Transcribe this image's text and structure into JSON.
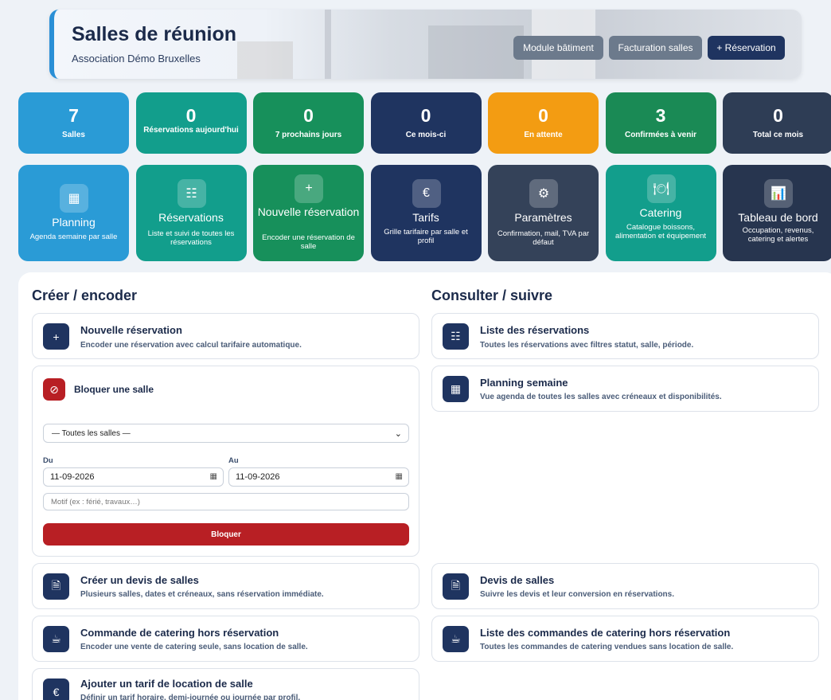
{
  "header": {
    "title": "Salles de réunion",
    "subtitle": "Association Démo Bruxelles",
    "buttons": [
      "Module bâtiment",
      "Facturation salles",
      "+ Réservation"
    ]
  },
  "stats": [
    {
      "value": "7",
      "label": "Salles",
      "color": "#2a9bd6"
    },
    {
      "value": "0",
      "label": "Réservations aujourd'hui",
      "color": "#129e8c"
    },
    {
      "value": "0",
      "label": "7 prochains jours",
      "color": "#17905b"
    },
    {
      "value": "0",
      "label": "Ce mois-ci",
      "color": "#1f3460"
    },
    {
      "value": "0",
      "label": "En attente",
      "color": "#f39c12"
    },
    {
      "value": "3",
      "label": "Confirmées à venir",
      "color": "#1a8a55"
    },
    {
      "value": "0",
      "label": "Total ce mois",
      "color": "#2e3d55"
    }
  ],
  "modules": [
    {
      "icon": "calendar-icon",
      "glyph": "▦",
      "title": "Planning",
      "desc": "Agenda semaine par salle",
      "color": "#2a9bd6"
    },
    {
      "icon": "list-icon",
      "glyph": "☷",
      "title": "Réservations",
      "desc": "Liste et suivi de toutes les réservations",
      "color": "#129e8c"
    },
    {
      "icon": "plus-icon",
      "glyph": "+",
      "title": "Nouvelle réservation",
      "desc": "Encoder une réservation de salle",
      "color": "#17905b"
    },
    {
      "icon": "euro-icon",
      "glyph": "€",
      "title": "Tarifs",
      "desc": "Grille tarifaire par salle et profil",
      "color": "#1f3460"
    },
    {
      "icon": "gear-icon",
      "glyph": "⚙",
      "title": "Paramètres",
      "desc": "Confirmation, mail, TVA par défaut",
      "color": "#344259"
    },
    {
      "icon": "plate-icon",
      "glyph": "🍽",
      "title": "Catering",
      "desc": "Catalogue boissons, alimentation et équipement",
      "color": "#129e8c"
    },
    {
      "icon": "bar-chart-icon",
      "glyph": "📊",
      "title": "Tableau de bord",
      "desc": "Occupation, revenus, catering et alertes",
      "color": "#27354f"
    }
  ],
  "left": {
    "title": "Créer / encoder",
    "new_res": {
      "title": "Nouvelle réservation",
      "desc": "Encoder une réservation avec calcul tarifaire automatique."
    },
    "block": {
      "title": "Bloquer une salle",
      "select_value": "— Toutes les salles —",
      "from_label": "Du",
      "to_label": "Au",
      "from_value": "11-09-2026",
      "to_value": "11-09-2026",
      "motif_placeholder": "Motif (ex : férié, travaux…)",
      "button": "Bloquer"
    },
    "devis": {
      "title": "Créer un devis de salles",
      "desc": "Plusieurs salles, dates et créneaux, sans réservation immédiate."
    },
    "catering": {
      "title": "Commande de catering hors réservation",
      "desc": "Encoder une vente de catering seule, sans location de salle."
    },
    "tarif": {
      "title": "Ajouter un tarif de location de salle",
      "desc": "Définir un tarif horaire, demi-journée ou journée par profil."
    }
  },
  "right": {
    "title": "Consulter / suivre",
    "list": {
      "title": "Liste des réservations",
      "desc": "Toutes les réservations avec filtres statut, salle, période."
    },
    "planning": {
      "title": "Planning semaine",
      "desc": "Vue agenda de toutes les salles avec créneaux et disponibilités."
    },
    "devis": {
      "title": "Devis de salles",
      "desc": "Suivre les devis et leur conversion en réservations."
    },
    "catering": {
      "title": "Liste des commandes de catering hors réservation",
      "desc": "Toutes les commandes de catering vendues sans location de salle."
    }
  }
}
